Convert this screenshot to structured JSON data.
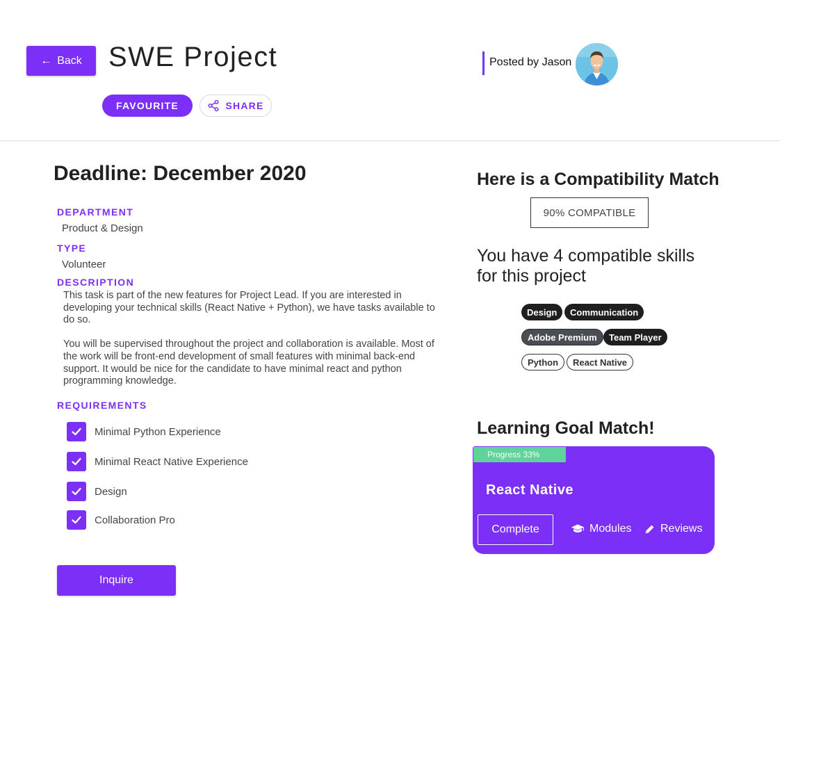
{
  "header": {
    "back_label": "Back",
    "title": "SWE Project",
    "favourite_label": "FAVOURITE",
    "share_label": "SHARE",
    "posted_by": "Posted by Jason"
  },
  "project": {
    "deadline": "Deadline: December 2020",
    "department_label": "DEPARTMENT",
    "department_value": "Product & Design",
    "type_label": "TYPE",
    "type_value": "Volunteer",
    "description_label": "DESCRIPTION",
    "description_p1": "This task is part of the new features for Project Lead. If you are interested in developing your technical skills (React Native + Python), we have tasks available to do so.",
    "description_p2": "You will be supervised throughout the project and collaboration is available. Most of the work will be front-end development of small features with minimal back-end support. It would be nice for the candidate to have minimal react and python programming knowledge.",
    "requirements_label": "REQUIREMENTS",
    "requirements": [
      {
        "label": "Minimal Python Experience",
        "checked": true
      },
      {
        "label": "Minimal React Native Experience",
        "checked": true
      },
      {
        "label": "Design",
        "checked": true
      },
      {
        "label": "Collaboration Pro",
        "checked": true
      }
    ],
    "inquire_label": "Inquire"
  },
  "compatibility": {
    "title": "Here is a Compatibility Match",
    "badge": "90% COMPATIBLE",
    "skills_text": "You have 4 compatible skills for this project",
    "skills": [
      {
        "label": "Design",
        "style": "dark"
      },
      {
        "label": "Communication",
        "style": "dark"
      },
      {
        "label": "Adobe Premium",
        "style": "gray"
      },
      {
        "label": "Team Player",
        "style": "dark"
      },
      {
        "label": "Python",
        "style": "outline"
      },
      {
        "label": "React Native",
        "style": "outline"
      }
    ]
  },
  "learning_goal": {
    "title": "Learning Goal Match!",
    "progress_label": "Progress 33%",
    "progress_value": 0.33,
    "course": "React Native",
    "complete_label": "Complete",
    "modules_label": "Modules",
    "reviews_label": "Reviews"
  },
  "colors": {
    "accent": "#7b2ff7",
    "progress": "#5fd39a",
    "chip_dark": "#1f1f1f"
  },
  "icons": [
    "arrow-left-icon",
    "share-icon",
    "check-icon",
    "graduation-cap-icon",
    "pencil-icon",
    "avatar-photo"
  ]
}
